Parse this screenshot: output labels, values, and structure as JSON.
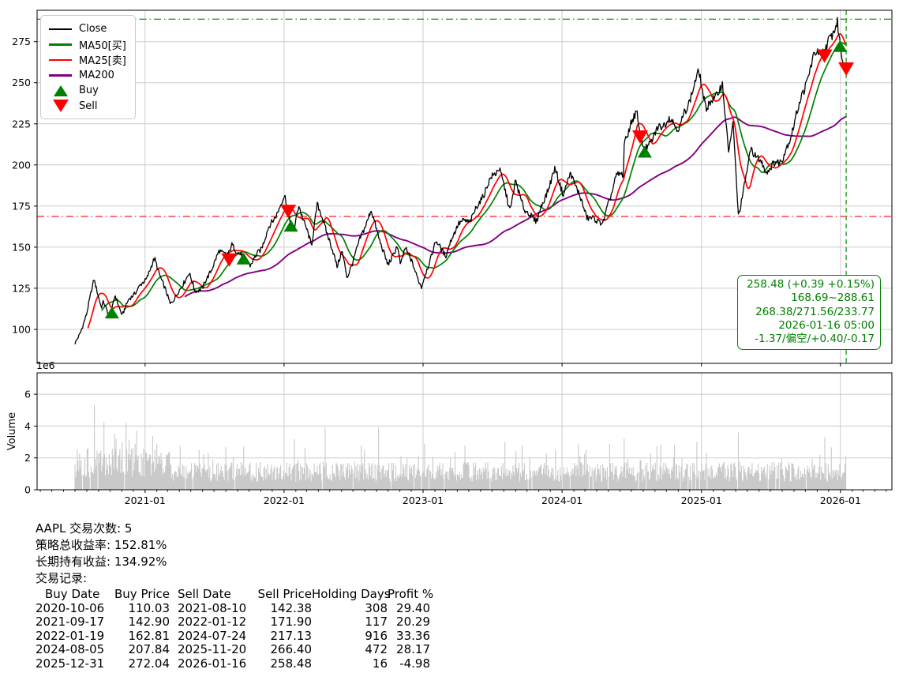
{
  "colors": {
    "close": "#000000",
    "ma50": "#008000",
    "ma25": "#ff0000",
    "ma200": "#800080",
    "buy_marker": "#008000",
    "sell_marker": "#ff0000",
    "grid": "#cccccc",
    "volume_bar": "#c9c9c9",
    "annotation_green": "#008000",
    "hline_high": "#2ca02c",
    "hline_low": "#ff4040",
    "tick_text": "#000000"
  },
  "legend": {
    "items": [
      {
        "label": "Close",
        "color": "#000000",
        "type": "line"
      },
      {
        "label": "MA50[买]",
        "color": "#008000",
        "type": "line"
      },
      {
        "label": "MA25[卖]",
        "color": "#ff0000",
        "type": "line"
      },
      {
        "label": "MA200",
        "color": "#800080",
        "type": "line"
      },
      {
        "label": "Buy",
        "color": "#008000",
        "type": "triangle-up"
      },
      {
        "label": "Sell",
        "color": "#ff0000",
        "type": "triangle-down"
      }
    ]
  },
  "annotation_box": {
    "lines": [
      "258.48 (+0.39 +0.15%)",
      "168.69~288.61",
      "268.38/271.56/233.77",
      "2026-01-16 05:00",
      "-1.37/偏空/+0.40/-0.17"
    ]
  },
  "price_axis": {
    "ticks": [
      100,
      125,
      150,
      175,
      200,
      225,
      250,
      275
    ]
  },
  "x_axis": {
    "labels": [
      "2021-01",
      "2022-01",
      "2023-01",
      "2024-01",
      "2025-01",
      "2026-01"
    ]
  },
  "volume_axis": {
    "ticks": [
      0,
      2,
      4,
      6
    ],
    "offset_label": "1e6",
    "ylabel": "Volume"
  },
  "chart_data": {
    "type": "line",
    "title": "",
    "xlabel": "",
    "ylabel": "",
    "x_range": [
      "2020-03-24",
      "2026-05-01"
    ],
    "price_ylim": [
      79,
      294
    ],
    "volume_ylim_1e6": [
      0,
      7.3
    ],
    "grid": true,
    "legend_position": "upper-left",
    "hlines": [
      {
        "price": 288.61,
        "color": "#2ca02c",
        "style": "dashdot"
      },
      {
        "price": 168.69,
        "color": "#ff4040",
        "style": "dashdot"
      }
    ],
    "vline": {
      "date": "2026-01-16",
      "color": "#2ca02c",
      "style": "dashed"
    },
    "close_control_points": [
      [
        "2020-07-01",
        91
      ],
      [
        "2020-07-12",
        96
      ],
      [
        "2020-08-01",
        109
      ],
      [
        "2020-08-20",
        131
      ],
      [
        "2020-09-08",
        113
      ],
      [
        "2020-09-14",
        117
      ],
      [
        "2020-10-01",
        108
      ],
      [
        "2020-10-06",
        112
      ],
      [
        "2020-10-14",
        121
      ],
      [
        "2020-11-02",
        109
      ],
      [
        "2020-11-20",
        118
      ],
      [
        "2020-12-10",
        123
      ],
      [
        "2021-01-05",
        131
      ],
      [
        "2021-01-26",
        143
      ],
      [
        "2021-03-08",
        116
      ],
      [
        "2021-04-01",
        123
      ],
      [
        "2021-04-26",
        134
      ],
      [
        "2021-05-12",
        123
      ],
      [
        "2021-06-01",
        125
      ],
      [
        "2021-07-15",
        148
      ],
      [
        "2021-08-10",
        146
      ],
      [
        "2021-08-16",
        151
      ],
      [
        "2021-09-17",
        143
      ],
      [
        "2021-10-04",
        139
      ],
      [
        "2021-11-01",
        149
      ],
      [
        "2021-11-19",
        161
      ],
      [
        "2021-12-15",
        172
      ],
      [
        "2022-01-03",
        181
      ],
      [
        "2022-01-12",
        172
      ],
      [
        "2022-01-19",
        163
      ],
      [
        "2022-01-27",
        159
      ],
      [
        "2022-02-09",
        175
      ],
      [
        "2022-03-14",
        151
      ],
      [
        "2022-03-29",
        177
      ],
      [
        "2022-04-29",
        156
      ],
      [
        "2022-05-20",
        138
      ],
      [
        "2022-06-02",
        148
      ],
      [
        "2022-06-16",
        130
      ],
      [
        "2022-07-07",
        146
      ],
      [
        "2022-08-17",
        173
      ],
      [
        "2022-09-30",
        139
      ],
      [
        "2022-10-25",
        150
      ],
      [
        "2022-11-03",
        138
      ],
      [
        "2022-11-15",
        150
      ],
      [
        "2022-12-28",
        126
      ],
      [
        "2023-02-03",
        154
      ],
      [
        "2023-03-02",
        145
      ],
      [
        "2023-04-03",
        164
      ],
      [
        "2023-05-04",
        166
      ],
      [
        "2023-06-30",
        193
      ],
      [
        "2023-07-19",
        198
      ],
      [
        "2023-08-18",
        172
      ],
      [
        "2023-09-01",
        189
      ],
      [
        "2023-09-26",
        172
      ],
      [
        "2023-10-26",
        167
      ],
      [
        "2023-12-14",
        197
      ],
      [
        "2024-01-05",
        181
      ],
      [
        "2024-01-24",
        195
      ],
      [
        "2024-02-13",
        183
      ],
      [
        "2024-03-07",
        169
      ],
      [
        "2024-04-19",
        165
      ],
      [
        "2024-05-21",
        192
      ],
      [
        "2024-06-10",
        194
      ],
      [
        "2024-06-12",
        213
      ],
      [
        "2024-07-15",
        234
      ],
      [
        "2024-07-24",
        218
      ],
      [
        "2024-08-05",
        209
      ],
      [
        "2024-09-06",
        221
      ],
      [
        "2024-10-07",
        227
      ],
      [
        "2024-11-04",
        222
      ],
      [
        "2024-12-26",
        258
      ],
      [
        "2025-01-13",
        234
      ],
      [
        "2025-02-25",
        247
      ],
      [
        "2025-03-13",
        209
      ],
      [
        "2025-03-25",
        224
      ],
      [
        "2025-04-08",
        169
      ],
      [
        "2025-05-12",
        211
      ],
      [
        "2025-06-20",
        196
      ],
      [
        "2025-08-01",
        203
      ],
      [
        "2025-08-20",
        214
      ],
      [
        "2025-09-05",
        230
      ],
      [
        "2025-09-26",
        246
      ],
      [
        "2025-10-28",
        269
      ],
      [
        "2025-11-20",
        267
      ],
      [
        "2025-12-05",
        277
      ],
      [
        "2025-12-24",
        285
      ],
      [
        "2025-12-31",
        272
      ],
      [
        "2026-01-08",
        263
      ],
      [
        "2026-01-16",
        258.48
      ]
    ],
    "ma_windows_days": {
      "MA25": 36,
      "MA50": 72,
      "MA200": 290
    },
    "volume_spikes_1e6": [
      [
        "2020-08-21",
        5.3
      ],
      [
        "2020-09-15",
        4.25
      ],
      [
        "2020-10-13",
        3.5
      ],
      [
        "2020-11-02",
        3.0
      ],
      [
        "2021-02-01",
        2.9
      ],
      [
        "2021-09-17",
        2.7
      ],
      [
        "2022-01-28",
        3.2
      ],
      [
        "2022-04-19",
        3.9
      ],
      [
        "2022-09-06",
        3.9
      ],
      [
        "2023-01-05",
        2.9
      ],
      [
        "2023-08-04",
        3.0
      ],
      [
        "2024-06-12",
        3.2
      ],
      [
        "2024-12-20",
        3.0
      ],
      [
        "2025-04-08",
        3.6
      ],
      [
        "2025-11-21",
        3.3
      ]
    ]
  },
  "summary": {
    "line_symbol_trades": "AAPL 交易次数: 5",
    "line_strategy_return": "策略总收益率: 152.81%",
    "line_hold_return": "长期持有收益: 134.92%",
    "line_records_title": "交易记录:",
    "table_header": [
      "Buy Date",
      "Buy Price",
      "Sell Date",
      "Sell Price",
      "Holding Days",
      "Profit %"
    ],
    "trades": [
      {
        "buy_date": "2020-10-06",
        "buy_price": "110.03",
        "sell_date": "2021-08-10",
        "sell_price": "142.38",
        "holding_days": "308",
        "profit_pct": "29.40"
      },
      {
        "buy_date": "2021-09-17",
        "buy_price": "142.90",
        "sell_date": "2022-01-12",
        "sell_price": "171.90",
        "holding_days": "117",
        "profit_pct": "20.29"
      },
      {
        "buy_date": "2022-01-19",
        "buy_price": "162.81",
        "sell_date": "2024-07-24",
        "sell_price": "217.13",
        "holding_days": "916",
        "profit_pct": "33.36"
      },
      {
        "buy_date": "2024-08-05",
        "buy_price": "207.84",
        "sell_date": "2025-11-20",
        "sell_price": "266.40",
        "holding_days": "472",
        "profit_pct": "28.17"
      },
      {
        "buy_date": "2025-12-31",
        "buy_price": "272.04",
        "sell_date": "2026-01-16",
        "sell_price": "258.48",
        "holding_days": "16",
        "profit_pct": "-4.98"
      }
    ]
  }
}
